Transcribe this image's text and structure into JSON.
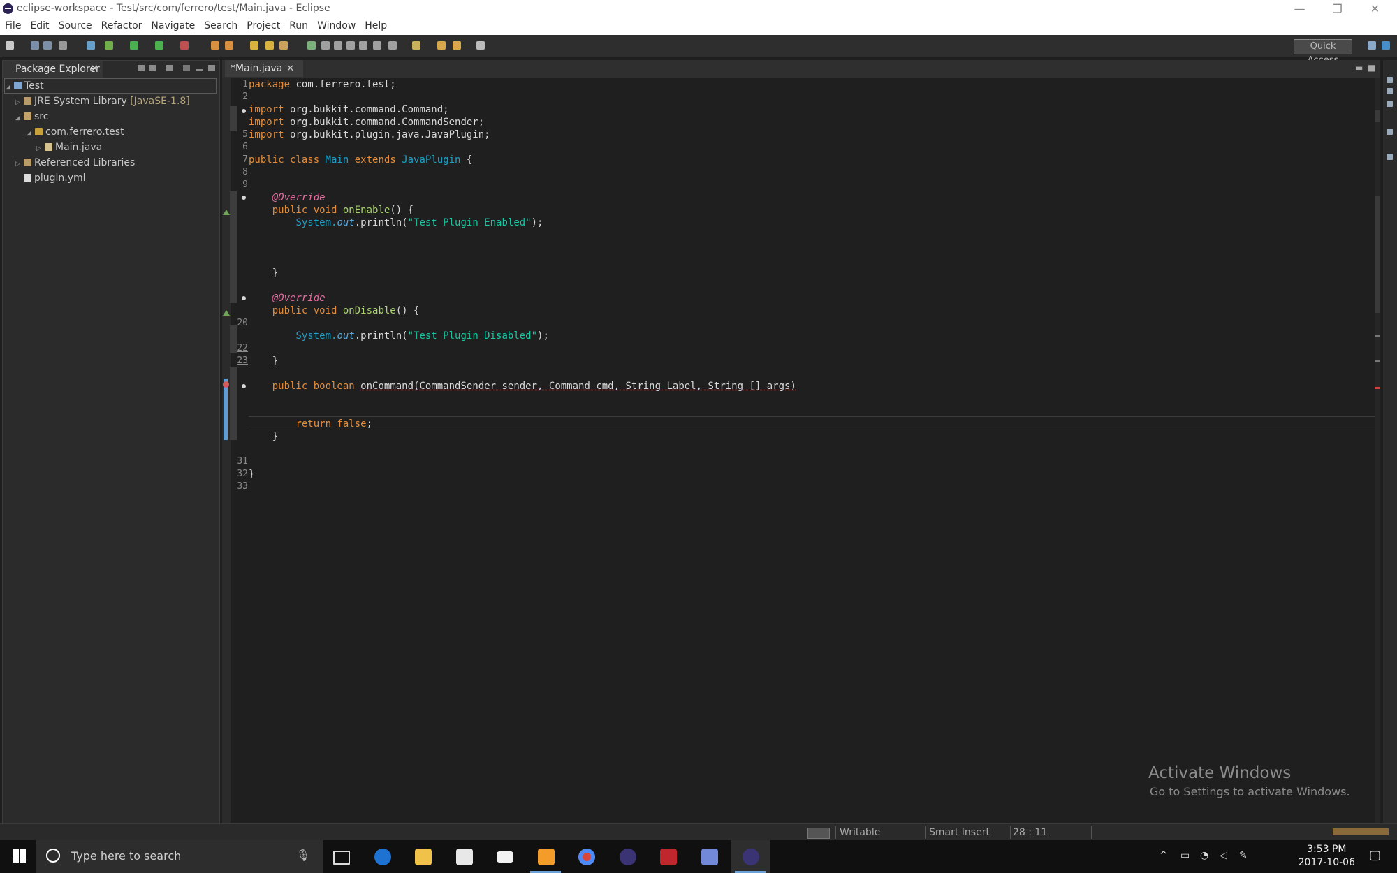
{
  "window": {
    "title": "eclipse-workspace - Test/src/com/ferrero/test/Main.java - Eclipse",
    "minimize": "—",
    "restore": "❐",
    "close": "✕"
  },
  "menu": [
    "File",
    "Edit",
    "Source",
    "Refactor",
    "Navigate",
    "Search",
    "Project",
    "Run",
    "Window",
    "Help"
  ],
  "toolbar": {
    "quick_access": "Quick Access"
  },
  "package_explorer": {
    "tab_label": "Package Explorer",
    "close": "✕",
    "tree": [
      {
        "label": "Test",
        "extra": "",
        "twisty": "◢",
        "icon": "project-icon"
      },
      {
        "label": "JRE System Library",
        "extra": "[JavaSE-1.8]",
        "twisty": "▷",
        "icon": "library-icon"
      },
      {
        "label": "src",
        "extra": "",
        "twisty": "◢",
        "icon": "source-folder-icon"
      },
      {
        "label": "com.ferrero.test",
        "extra": "",
        "twisty": "◢",
        "icon": "package-icon"
      },
      {
        "label": "Main.java",
        "extra": "",
        "twisty": "▷",
        "icon": "java-file-icon"
      },
      {
        "label": "Referenced Libraries",
        "extra": "",
        "twisty": "▷",
        "icon": "library-icon"
      },
      {
        "label": "plugin.yml",
        "extra": "",
        "twisty": "",
        "icon": "file-icon"
      }
    ]
  },
  "editor": {
    "tab_label": "*Main.java",
    "close": "✕",
    "line_numbers": {
      "1": "1",
      "2": "2",
      "5": "5",
      "6": "6",
      "7": "7",
      "8": "8",
      "9": "9",
      "20": "20",
      "22": "22",
      "23": "23",
      "31": "31",
      "32": "32",
      "33": "33"
    },
    "code": {
      "l1_kw": "package",
      "l1_rest": " com.ferrero.test;",
      "l3_kw": "import",
      "l3_rest": " org.bukkit.command.Command;",
      "l4_kw": "import",
      "l4_rest": " org.bukkit.command.CommandSender;",
      "l5_kw": "import",
      "l5_rest": " org.bukkit.plugin.java.JavaPlugin;",
      "l7_kw1": "public class",
      "l7_cls": "Main",
      "l7_kw2": "extends",
      "l7_cls2": "JavaPlugin",
      "l7_rest": " {",
      "l10_ann": "@Override",
      "l11_kw": "public void",
      "l11_fn": "onEnable",
      "l11_rest": "() {",
      "l12_cls": "System.",
      "l12_out": "out",
      "l12_mid": ".println(",
      "l12_str": "\"Test Plugin Enabled\"",
      "l12_end": ");",
      "l16_rest": "}",
      "l18_ann": "@Override",
      "l19_kw": "public void",
      "l19_fn": "onDisable",
      "l19_rest": "() {",
      "l21_cls": "System.",
      "l21_out": "out",
      "l21_mid": ".println(",
      "l21_str": "\"Test Plugin Disabled\"",
      "l21_end": ");",
      "l23_rest": "}",
      "l25_kw": "public boolean",
      "l25_rest": "onCommand(CommandSender sender, Command cmd, String Label, String [] args)",
      "l28_kw": "return false",
      "l28_end": ";",
      "l29_rest": "}",
      "l32_rest": "}"
    }
  },
  "watermark": {
    "line1": "Activate Windows",
    "line2": "Go to Settings to activate Windows."
  },
  "status": {
    "writable": "Writable",
    "insert_mode": "Smart Insert",
    "cursor": "28 : 11"
  },
  "taskbar": {
    "search_placeholder": "Type here to search",
    "time": "3:53 PM",
    "date": "2017-10-06"
  }
}
